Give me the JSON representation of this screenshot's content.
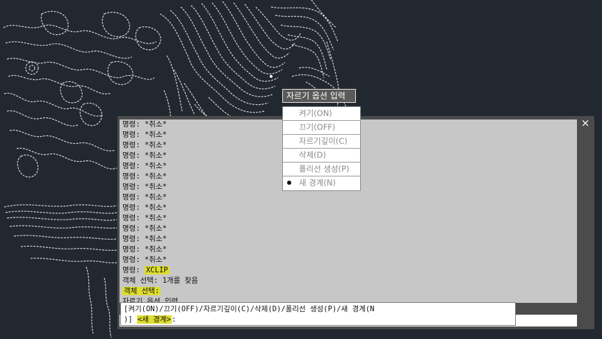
{
  "drawing": {
    "background": "#212830",
    "line_color": "#d8d8d8"
  },
  "tooltip": {
    "text": "자르기 옵션 입력"
  },
  "option_menu": {
    "items": [
      {
        "label": "켜기(ON)",
        "selected": false
      },
      {
        "label": "끄기(OFF)",
        "selected": false
      },
      {
        "label": "자르기깊이(C)",
        "selected": false
      },
      {
        "label": "삭제(D)",
        "selected": false
      },
      {
        "label": "폴리선 생성(P)",
        "selected": false
      },
      {
        "label": "새 경계(N)",
        "selected": true
      }
    ]
  },
  "command_window": {
    "close_label": "×",
    "history": {
      "cancel_prefix": "명령:",
      "cancel_value": "*취소*",
      "cancel_count": 14,
      "xclip_prefix": "명령:",
      "xclip_cmd": "XCLIP",
      "select_found": "객체 선택: 1개를 찾음",
      "select_prompt": "객체 선택:",
      "partial_line": "자르기 옵션 입력"
    },
    "prompt": {
      "line1": "[켜기(ON)/끄기(OFF)/자르기깊이(C)/삭제(D)/폴리선 생성(P)/새 경계(N",
      "line2_prefix": ")] ",
      "default_option": "<새 경계>",
      "line2_suffix": ":"
    },
    "highlight_color": "#dede2e"
  }
}
